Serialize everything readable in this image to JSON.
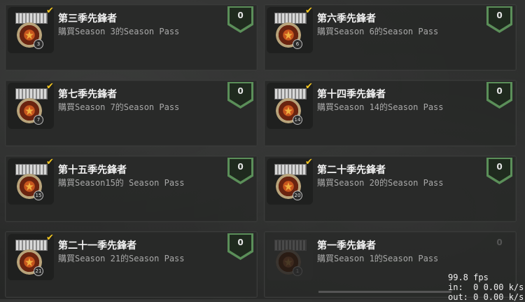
{
  "achievements": [
    {
      "title": "第三季先鋒者",
      "desc": "購買Season 3的Season Pass",
      "badge": "3",
      "count": "0",
      "unlocked": true
    },
    {
      "title": "第六季先鋒者",
      "desc": "購買Season 6的Season Pass",
      "badge": "6",
      "count": "0",
      "unlocked": true
    },
    {
      "title": "第七季先鋒者",
      "desc": "購買Season 7的Season Pass",
      "badge": "7",
      "count": "0",
      "unlocked": true
    },
    {
      "title": "第十四季先鋒者",
      "desc": "購買Season 14的Season Pass",
      "badge": "14",
      "count": "0",
      "unlocked": true
    },
    {
      "title": "第十五季先鋒者",
      "desc": "購買Season15的 Season Pass",
      "badge": "15",
      "count": "0",
      "unlocked": true
    },
    {
      "title": "第二十季先鋒者",
      "desc": "購買Season 20的Season Pass",
      "badge": "20",
      "count": "0",
      "unlocked": true
    },
    {
      "title": "第二十一季先鋒者",
      "desc": "購買Season 21的Season Pass",
      "badge": "21",
      "count": "0",
      "unlocked": true
    },
    {
      "title": "第一季先鋒者",
      "desc": "購買Season 1的Season Pass",
      "badge": "1",
      "count": "0",
      "unlocked": false
    }
  ],
  "overlay": {
    "fps": "99.8 fps",
    "in": "in:  0 0.00 k/s",
    "out": "out: 0 0.00 k/s"
  },
  "colors": {
    "shield": "#5b8f59",
    "check": "#f3c622"
  }
}
